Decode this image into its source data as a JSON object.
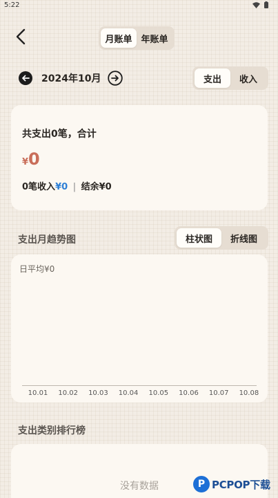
{
  "status_bar": {
    "time": "5:22"
  },
  "header": {
    "period_tabs": [
      {
        "label": "月账单",
        "active": true
      },
      {
        "label": "年账单",
        "active": false
      }
    ]
  },
  "month_nav": {
    "label": "2024年10月"
  },
  "type_tabs": [
    {
      "label": "支出",
      "active": true
    },
    {
      "label": "收入",
      "active": false
    }
  ],
  "summary": {
    "line1_prefix": "共支出",
    "expense_count": "0",
    "line1_suffix": "笔，合计",
    "currency": "¥",
    "total": "0",
    "income_count": "0",
    "income_label": "笔收入",
    "income_amount": "¥0",
    "separator": "|",
    "balance_label": "结余¥0"
  },
  "trend": {
    "title": "支出月趋势图",
    "chart_tabs": [
      {
        "label": "柱状图",
        "active": true
      },
      {
        "label": "折线图",
        "active": false
      }
    ],
    "daily_avg": "日平均¥0"
  },
  "chart_data": {
    "type": "bar",
    "categories": [
      "10.01",
      "10.02",
      "10.03",
      "10.04",
      "10.05",
      "10.06",
      "10.07",
      "10.08"
    ],
    "values": [
      0,
      0,
      0,
      0,
      0,
      0,
      0,
      0
    ],
    "title": "",
    "xlabel": "",
    "ylabel": "",
    "grid": false
  },
  "ranking": {
    "title": "支出类别排行榜",
    "empty_text": "没有数据"
  },
  "watermark": {
    "logo_letter": "P",
    "text": "PCPOP下载"
  },
  "colors": {
    "background": "#f3ede5",
    "card": "#fcf8f2",
    "expense_amount": "#c96e5a",
    "income_amount": "#2d7fd6",
    "segment_bg": "#e6ddd2"
  }
}
